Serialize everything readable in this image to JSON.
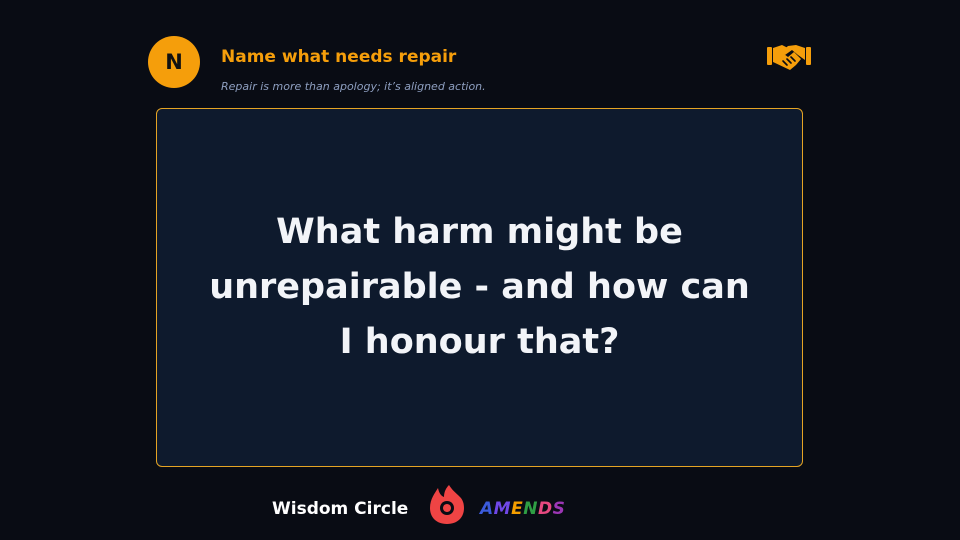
{
  "header": {
    "badge_letter": "N",
    "title": "Name what needs repair",
    "subtitle": "Repair is more than apology; it’s aligned action.",
    "icon": "handshake-icon"
  },
  "card": {
    "question": "What harm might be unrepairable - and how can I honour that?"
  },
  "footer": {
    "brand": "Wisdom Circle",
    "logo_icon": "flame-logo-icon",
    "program_letters": [
      "A",
      "M",
      "E",
      "N",
      "D",
      "S"
    ],
    "program_colors": [
      "#3b5bdb",
      "#7048e8",
      "#f59f00",
      "#2f9e44",
      "#e64980",
      "#9c36b5"
    ]
  },
  "colors": {
    "background": "#090c14",
    "accent": "#f59e0b",
    "card_background": "#0e1a2d",
    "card_border": "#e5a424",
    "logo": "#ef4444"
  }
}
